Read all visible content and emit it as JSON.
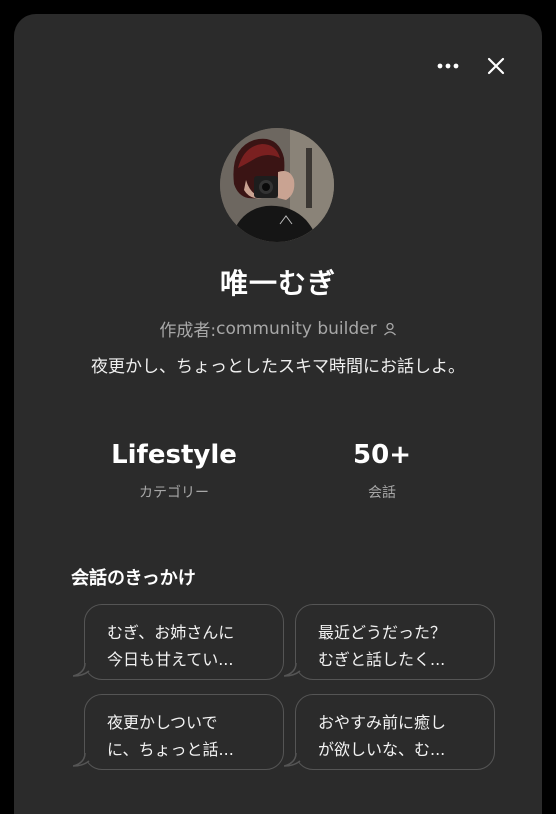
{
  "header": {
    "more_icon": "more-horizontal-icon",
    "close_icon": "close-icon"
  },
  "profile": {
    "name": "唯一むぎ",
    "creator_prefix": "作成者: ",
    "creator_name": "community builder",
    "creator_icon": "person-icon",
    "description": "夜更かし、ちょっとしたスキマ時間にお話しよ。"
  },
  "stats": [
    {
      "value": "Lifestyle",
      "label": "カテゴリー"
    },
    {
      "value": "50+",
      "label": "会話"
    }
  ],
  "starters": {
    "title": "会話のきっかけ",
    "items": [
      {
        "line1": "むぎ、お姉さんに",
        "line2": "今日も甘えてい..."
      },
      {
        "line1": "最近どうだった？",
        "line2": "むぎと話したく..."
      },
      {
        "line1": "夜更かしついで",
        "line2": "に、ちょっと話..."
      },
      {
        "line1": "おやすみ前に癒し",
        "line2": "が欲しいな、む..."
      }
    ]
  },
  "colors": {
    "background": "#2b2b2b",
    "text_secondary": "#a7a7a7",
    "chip_border": "#555555"
  }
}
